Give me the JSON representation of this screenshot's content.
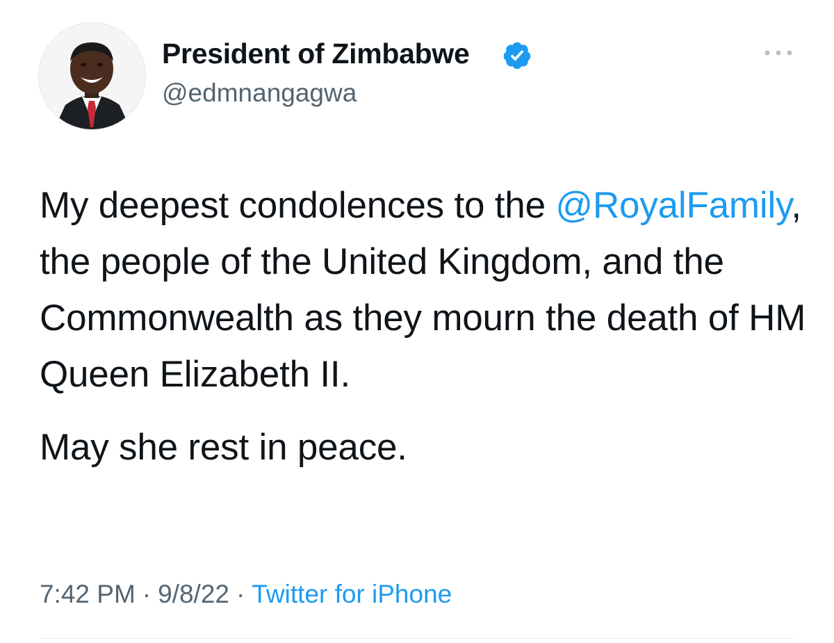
{
  "author": {
    "display_name": "President of Zimbabwe",
    "handle": "@edmnangagwa",
    "verified": true,
    "verified_icon": "verified-badge-icon",
    "avatar_icon": "profile-photo"
  },
  "more_icon": "more-options-icon",
  "tweet": {
    "p1_before": "My deepest condolences to the ",
    "mention": "@RoyalFamily",
    "p1_after": ", the people of the United Kingdom, and the Commonwealth as they mourn the death of HM Queen Elizabeth II.",
    "p2": "May she rest in peace."
  },
  "meta": {
    "time": "7:42 PM",
    "separator": "·",
    "date": "9/8/22",
    "source": "Twitter for iPhone"
  },
  "colors": {
    "link": "#1d9bf0",
    "secondary_text": "#536471",
    "primary_text": "#0f1419"
  }
}
